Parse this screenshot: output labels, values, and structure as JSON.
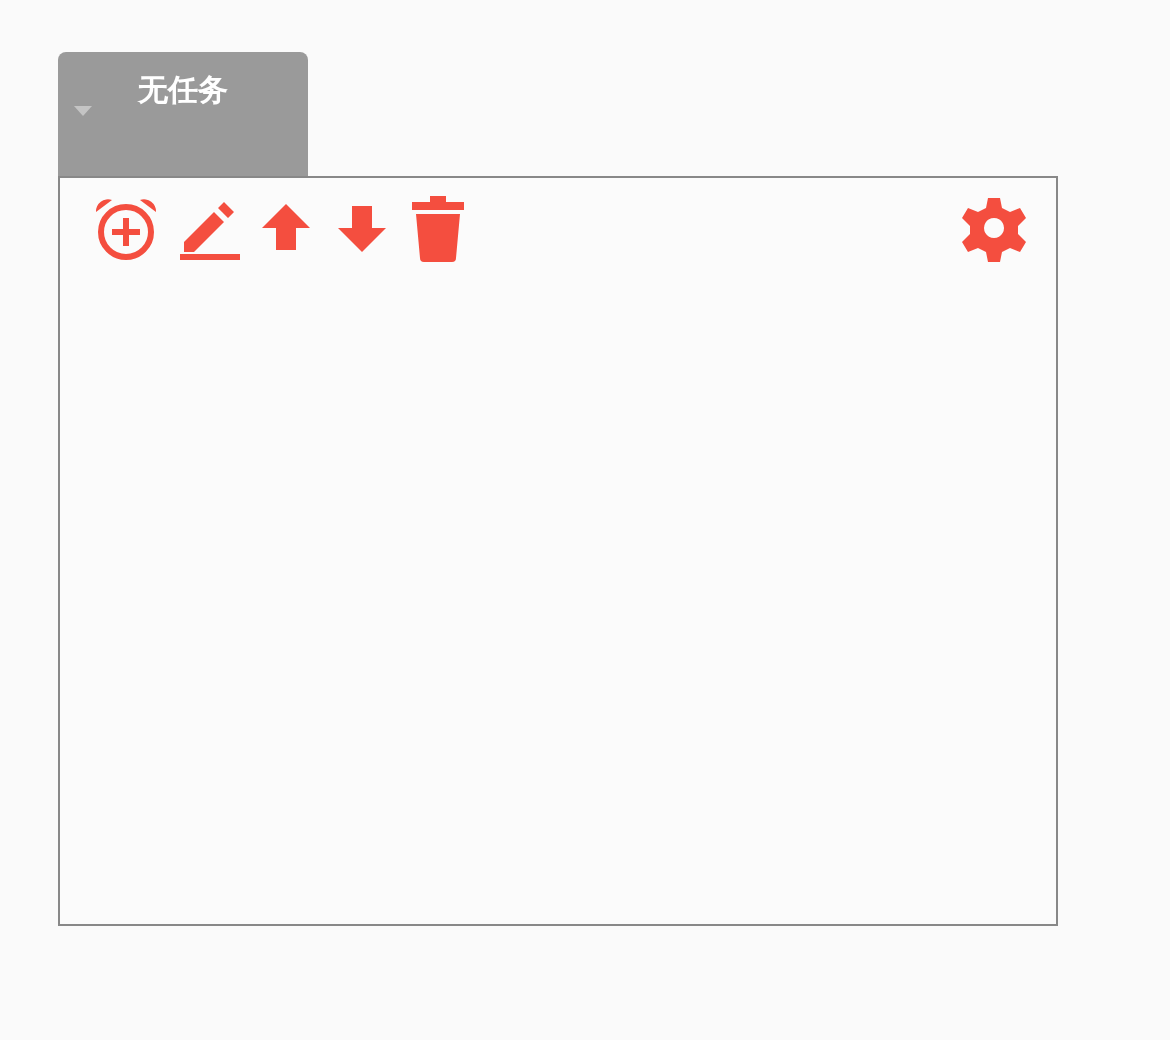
{
  "task_tab": {
    "label": "无任务"
  }
}
